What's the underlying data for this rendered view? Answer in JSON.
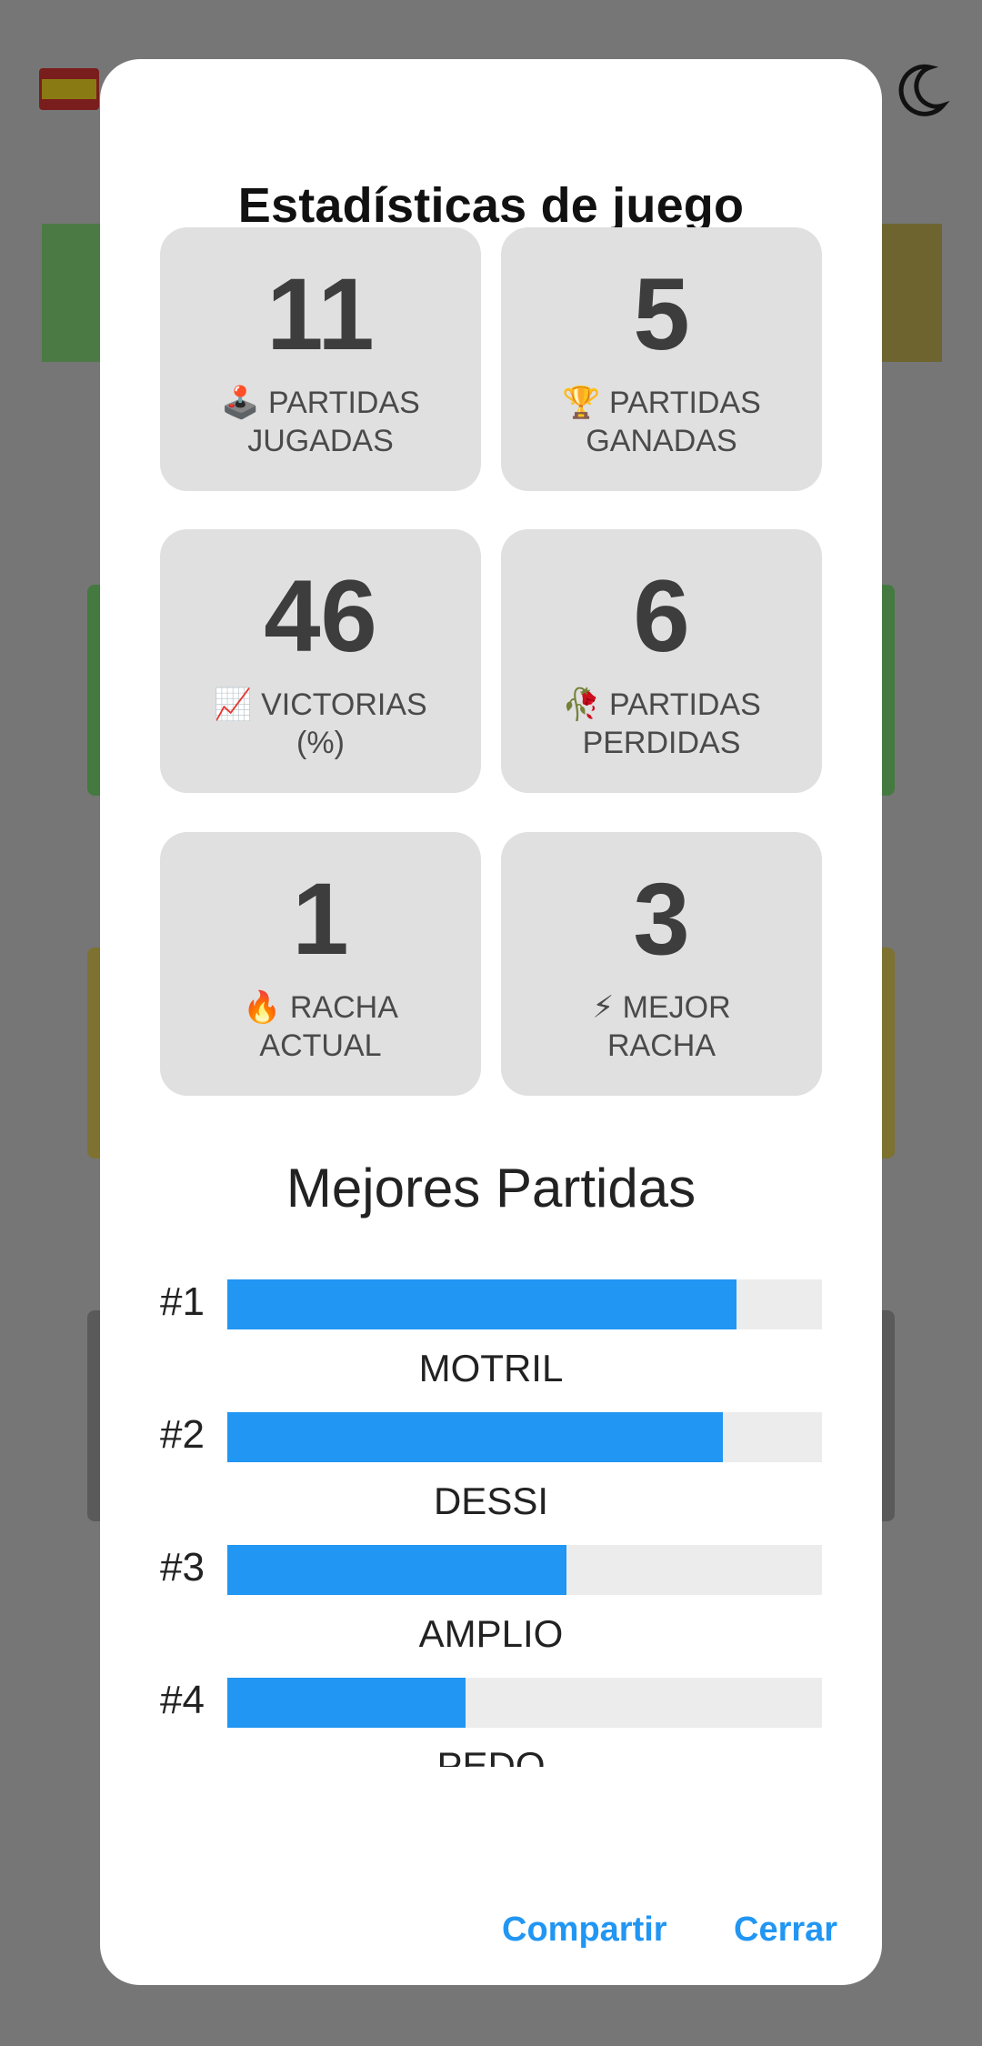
{
  "dialog": {
    "title": "Estadísticas de juego",
    "stats": [
      {
        "value": "11",
        "icon": "🕹️",
        "icon_name": "joystick-icon",
        "label": "PARTIDAS",
        "label2": "JUGADAS"
      },
      {
        "value": "5",
        "icon": "🏆",
        "icon_name": "trophy-icon",
        "label": "PARTIDAS",
        "label2": "GANADAS"
      },
      {
        "value": "46",
        "icon": "📈",
        "icon_name": "chart-increasing-icon",
        "label": "VICTORIAS",
        "label2": "(%)"
      },
      {
        "value": "6",
        "icon": "🥀",
        "icon_name": "wilted-flower-icon",
        "label": "PARTIDAS",
        "label2": "PERDIDAS"
      },
      {
        "value": "1",
        "icon": "🔥",
        "icon_name": "fire-icon",
        "label": "RACHA",
        "label2": "ACTUAL"
      },
      {
        "value": "3",
        "icon": "⚡",
        "icon_name": "lightning-icon",
        "label": "MEJOR",
        "label2": "RACHA"
      }
    ],
    "best_games_title": "Mejores Partidas",
    "best_games": [
      {
        "rank": "#1",
        "word": "MOTRIL",
        "fill": 0.857
      },
      {
        "rank": "#2",
        "word": "DESSI",
        "fill": 0.833
      },
      {
        "rank": "#3",
        "word": "AMPLIO",
        "fill": 0.571
      },
      {
        "rank": "#4",
        "word": "PEDO",
        "fill": 0.4
      }
    ],
    "share_label": "Compartir",
    "close_label": "Cerrar"
  },
  "colors": {
    "accent": "#2196f3",
    "card_bg": "#e0e0e0",
    "track_bg": "#ececec",
    "overlay": "#767676"
  }
}
